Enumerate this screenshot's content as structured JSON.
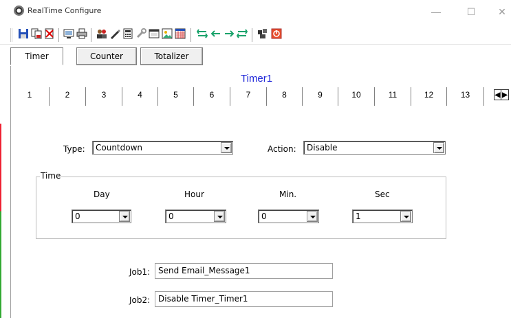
{
  "window": {
    "title": "RealTime Configure",
    "min_glyph": "—",
    "max_glyph": "☐",
    "close_glyph": "✕"
  },
  "toolbar": {
    "icons": [
      "save-icon",
      "copy-icon",
      "delete-icon",
      "monitor-icon",
      "print-icon",
      "users-icon",
      "pen-icon",
      "calculator-icon",
      "tools-icon",
      "window-icon",
      "image-icon",
      "grid-icon",
      "first-icon",
      "prev-icon",
      "next-icon",
      "last-icon",
      "plugin-icon",
      "stop-icon"
    ]
  },
  "mode_tabs": [
    "Timer",
    "Counter",
    "Totalizer"
  ],
  "timer_title": "Timer1",
  "number_tabs": [
    "1",
    "2",
    "3",
    "4",
    "5",
    "6",
    "7",
    "8",
    "9",
    "10",
    "11",
    "12",
    "13"
  ],
  "form": {
    "type_label": "Type:",
    "type_value": "Countdown",
    "action_label": "Action:",
    "action_value": "Disable",
    "time_group_label": "Time",
    "day_label": "Day",
    "day_value": "0",
    "hour_label": "Hour",
    "hour_value": "0",
    "min_label": "Min.",
    "min_value": "0",
    "sec_label": "Sec",
    "sec_value": "1",
    "job1_label": "Job1:",
    "job1_value": "Send Email_Message1",
    "job2_label": "Job2:",
    "job2_value": "Disable Timer_Timer1"
  },
  "colors": {
    "timer_title": "#1f27d9",
    "toolbar_arrows": "#1aa36b",
    "stop_icon": "#e84c2b"
  }
}
